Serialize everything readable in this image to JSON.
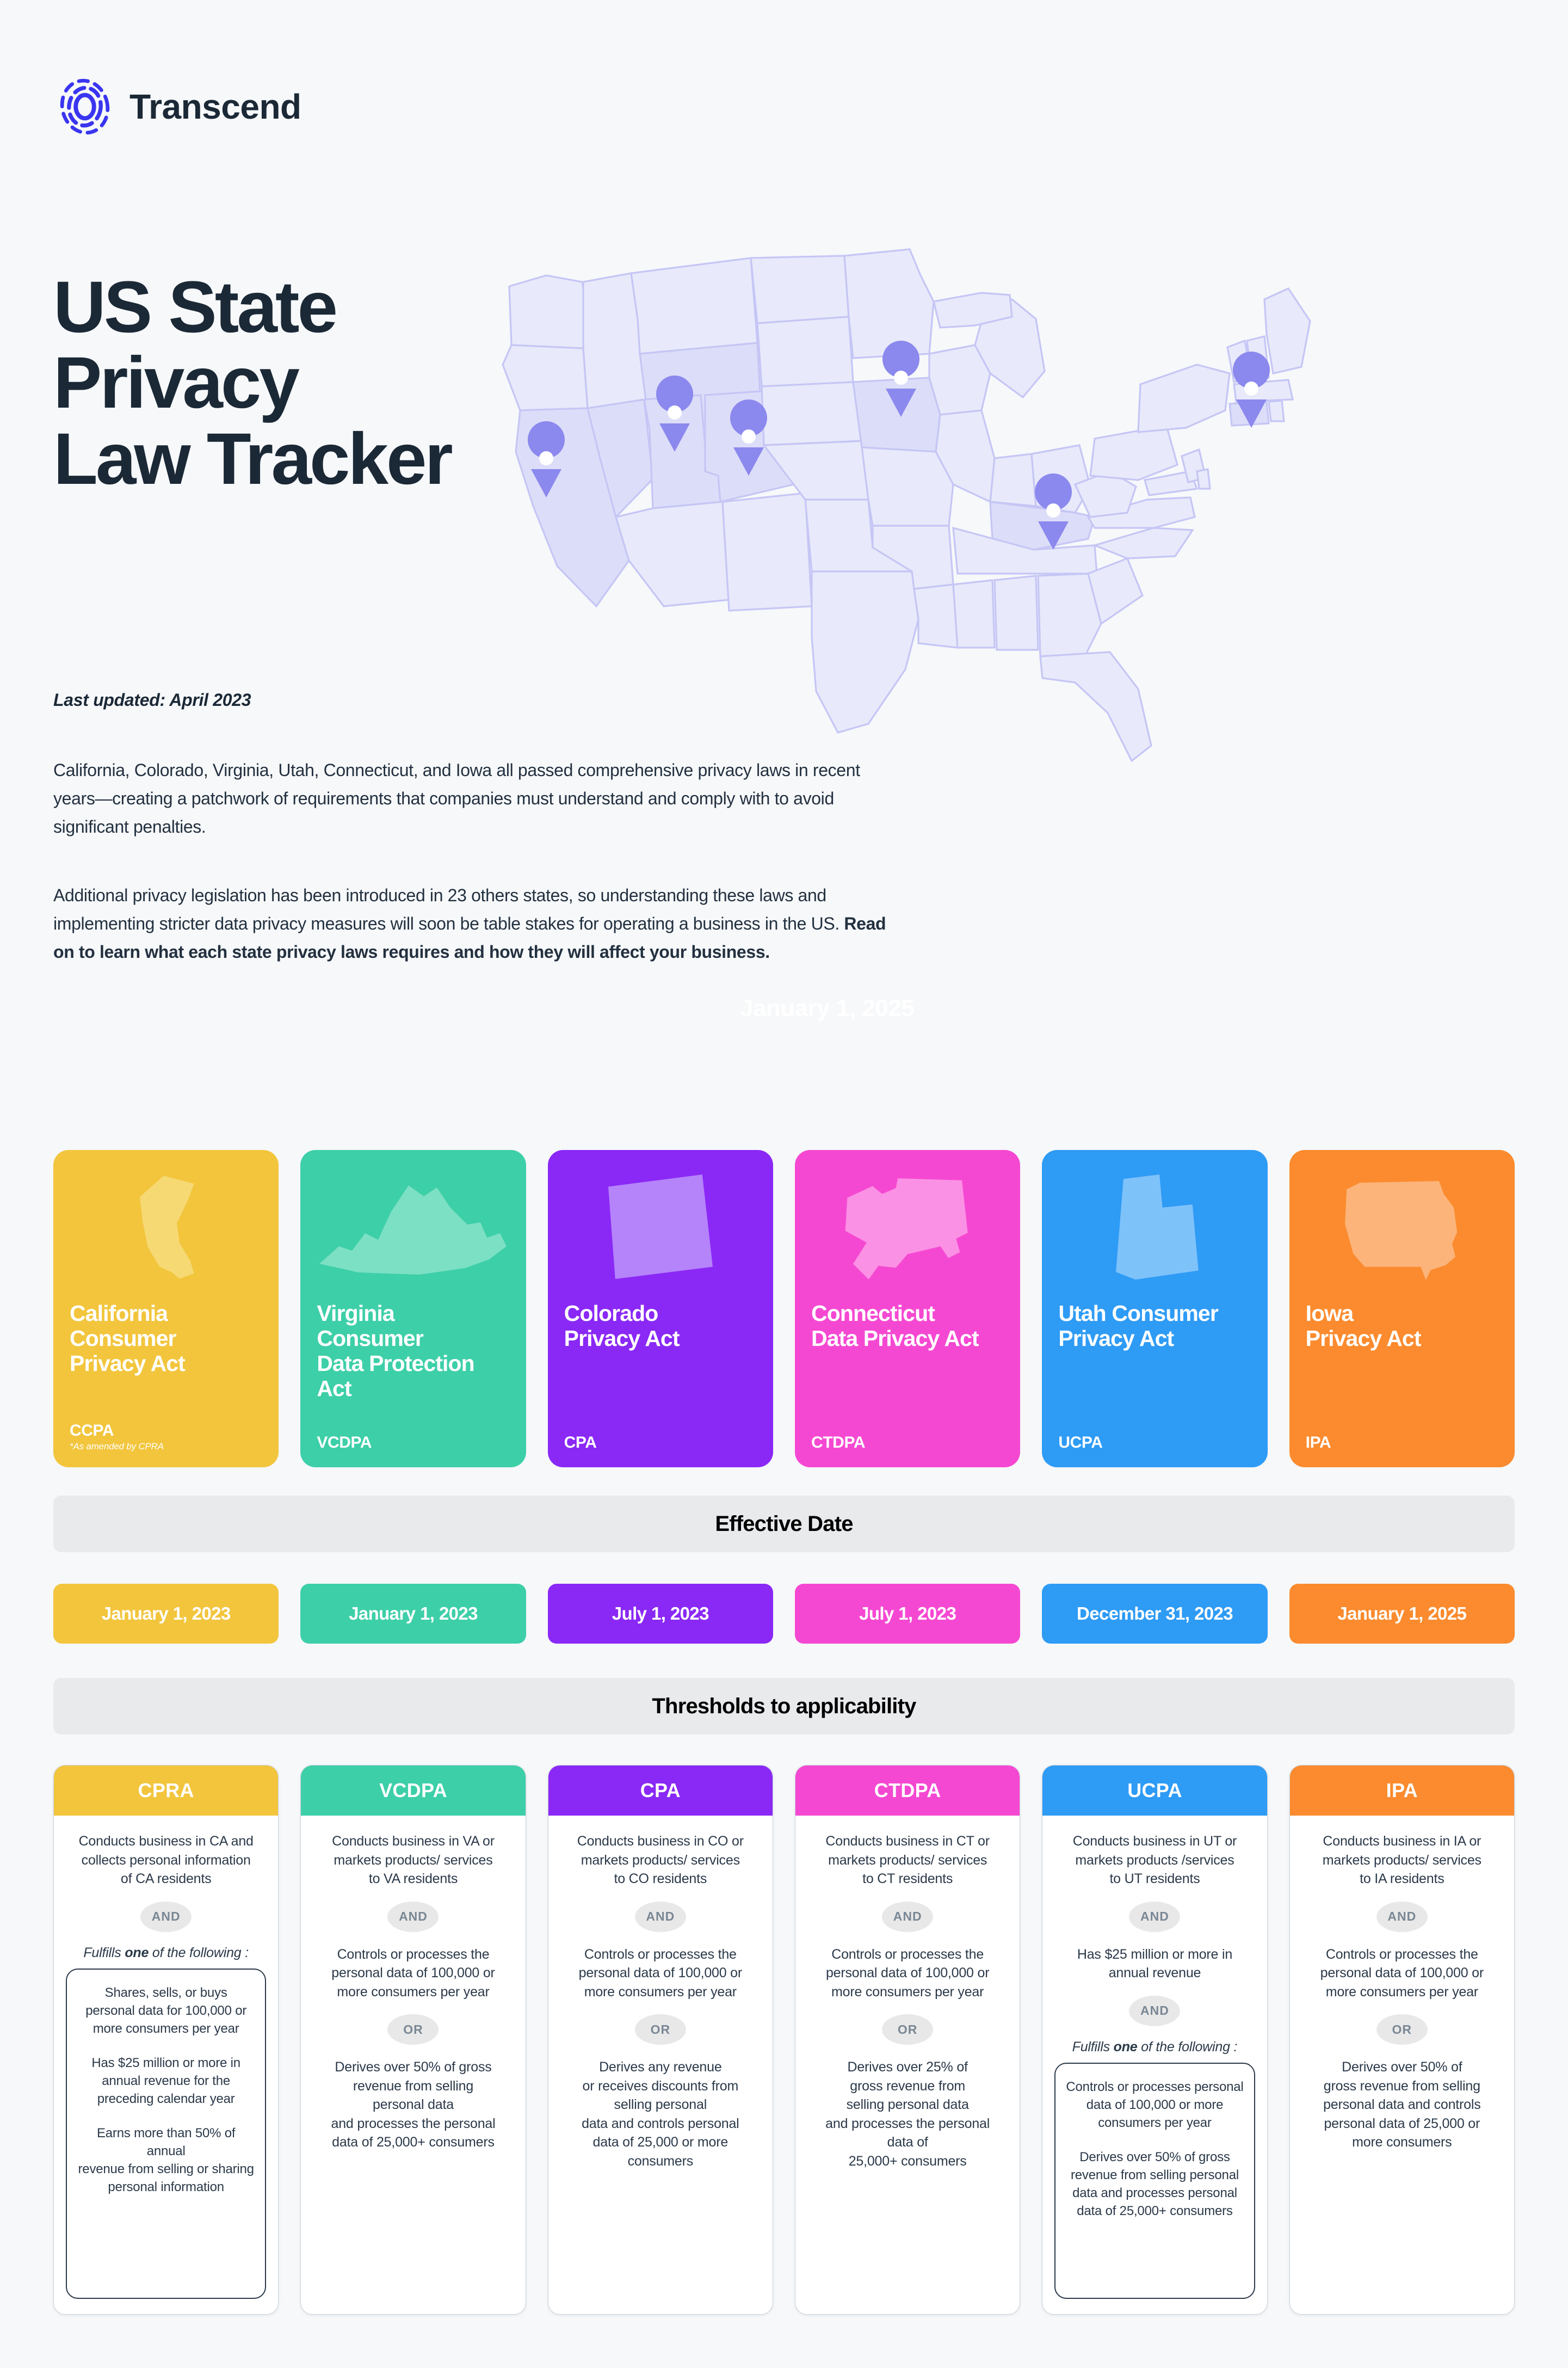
{
  "brand": {
    "name": "Transcend",
    "logo_icon": "transcend-fingerprint-logo",
    "accent": "#3A35F0",
    "wordmark_color": "#1B2836"
  },
  "hero": {
    "title": "US State\nPrivacy\nLaw Tracker",
    "updated": "Last updated: April 2023",
    "paragraph_1": "California, Colorado, Virginia,  Utah, Connecticut, and Iowa all passed comprehensive privacy laws in recent years—creating a patchwork of requirements that companies must understand and comply with to avoid significant penalties.",
    "paragraph_2_lead": "Additional privacy legislation has been introduced in 23 others states, so understanding these laws and implementing stricter data privacy measures will soon be table stakes for operating a business in the US. ",
    "paragraph_2_bold": "Read on to learn what each state privacy laws requires and how they will affect your business.",
    "ghost_date": "January 1, 2025"
  },
  "map": {
    "icon": "us-map",
    "state_fill": "#E8E9FA",
    "highlight_fill": "#DCDDF8",
    "border": "#C5C6F5",
    "pin_color": "#8B88EE",
    "pins": [
      "California",
      "Utah",
      "Colorado",
      "Iowa",
      "Kentucky",
      "Connecticut"
    ]
  },
  "cards": [
    {
      "name": "California\nConsumer\nPrivacy Act",
      "abbr": "CCPA",
      "note": "*As amended by CPRA",
      "color": "#F2C53D",
      "shape_icon": "california-state-shape",
      "shape_fill": "#F7D974"
    },
    {
      "name": "Virginia\nConsumer\nData Protection\nAct",
      "abbr": "VCDPA",
      "note": "",
      "color": "#3DCFA8",
      "shape_icon": "virginia-state-shape",
      "shape_fill": "#7CE0C4"
    },
    {
      "name": "Colorado\nPrivacy Act",
      "abbr": "CPA",
      "note": "",
      "color": "#8A28F5",
      "shape_icon": "colorado-state-shape",
      "shape_fill": "#B583FA"
    },
    {
      "name": "Connecticut\nData Privacy Act",
      "abbr": "CTDPA",
      "note": "",
      "color": "#F548D2",
      "shape_icon": "connecticut-state-shape",
      "shape_fill": "#FB91E5"
    },
    {
      "name": "Utah Consumer\nPrivacy Act",
      "abbr": "UCPA",
      "note": "",
      "color": "#2E9BF5",
      "shape_icon": "utah-state-shape",
      "shape_fill": "#7EC2FA"
    },
    {
      "name": "Iowa\nPrivacy Act",
      "abbr": "IPA",
      "note": "",
      "color": "#FB8B2E",
      "shape_icon": "iowa-state-shape",
      "shape_fill": "#FCB47A"
    }
  ],
  "sections": {
    "effective_date_label": "Effective Date",
    "thresholds_label": "Thresholds to applicability"
  },
  "effective_dates": [
    {
      "label": "January 1, 2023",
      "color": "#F2C53D"
    },
    {
      "label": "January 1, 2023",
      "color": "#3DCFA8"
    },
    {
      "label": "July 1, 2023",
      "color": "#8A28F5"
    },
    {
      "label": "July 1, 2023",
      "color": "#F548D2"
    },
    {
      "label": "December 31, 2023",
      "color": "#2E9BF5"
    },
    {
      "label": "January 1, 2025",
      "color": "#FB8B2E"
    }
  ],
  "thresholds": [
    {
      "header": "CPRA",
      "color": "#F2C53D",
      "crit1": "Conducts business in CA and\ncollects personal information\nof CA residents",
      "conn1": "AND",
      "fulfill_pre": "Fulfills ",
      "fulfill_bold": "one",
      "fulfill_post": " of the following :",
      "sub_items": [
        "Shares, sells, or buys\npersonal data for 100,000 or\nmore consumers per year",
        "Has $25 million or more in\nannual revenue for the\npreceding calendar year",
        "Earns more than 50% of  annual\nrevenue from selling or sharing\npersonal information"
      ]
    },
    {
      "header": "VCDPA",
      "color": "#3DCFA8",
      "crit1": "Conducts business in VA or\nmarkets products/ services\nto VA residents",
      "conn1": "AND",
      "crit2": "Controls or processes the\npersonal data of 100,000 or\nmore consumers per year",
      "conn2": "OR",
      "crit3": "Derives over 50% of  gross\nrevenue from  selling\npersonal data\nand processes the personal\ndata of 25,000+ consumers"
    },
    {
      "header": "CPA",
      "color": "#8A28F5",
      "crit1": "Conducts business in CO or\nmarkets products/ services\nto CO residents",
      "conn1": "AND",
      "crit2": "Controls or processes the\npersonal data of 100,000 or\nmore consumers per year",
      "conn2": "OR",
      "crit3": "Derives any revenue\nor receives discounts from\nselling personal\ndata and controls personal\ndata of 25,000 or more\nconsumers"
    },
    {
      "header": "CTDPA",
      "color": "#F548D2",
      "crit1": "Conducts business in CT or\nmarkets products/ services\nto CT residents",
      "conn1": "AND",
      "crit2": "Controls or processes the\npersonal data of 100,000 or\nmore consumers per year",
      "conn2": "OR",
      "crit3": "Derives over 25% of\ngross revenue from\nselling personal data\nand processes the personal\ndata of\n25,000+ consumers"
    },
    {
      "header": "UCPA",
      "color": "#2E9BF5",
      "crit1": "Conducts business in UT or\nmarkets products /services\nto UT residents",
      "conn1": "AND",
      "crit2": "Has $25 million or more in\nannual revenue",
      "conn2": "AND",
      "fulfill_pre": "Fulfills ",
      "fulfill_bold": "one",
      "fulfill_post": " of the following :",
      "sub_items": [
        "Controls or processes personal\ndata of 100,000 or more\nconsumers per year",
        "Derives over 50% of gross\nrevenue from selling personal\ndata and processes personal\ndata of 25,000+ consumers"
      ]
    },
    {
      "header": "IPA",
      "color": "#FB8B2E",
      "crit1": "Conducts business in IA or\nmarkets products/ services\nto IA residents",
      "conn1": "AND",
      "crit2": "Controls or processes the\npersonal data of 100,000 or\nmore consumers per year",
      "conn2": "OR",
      "crit3": "Derives over 50% of\ngross revenue from selling\npersonal data and controls\npersonal data of 25,000 or\nmore consumers"
    }
  ]
}
